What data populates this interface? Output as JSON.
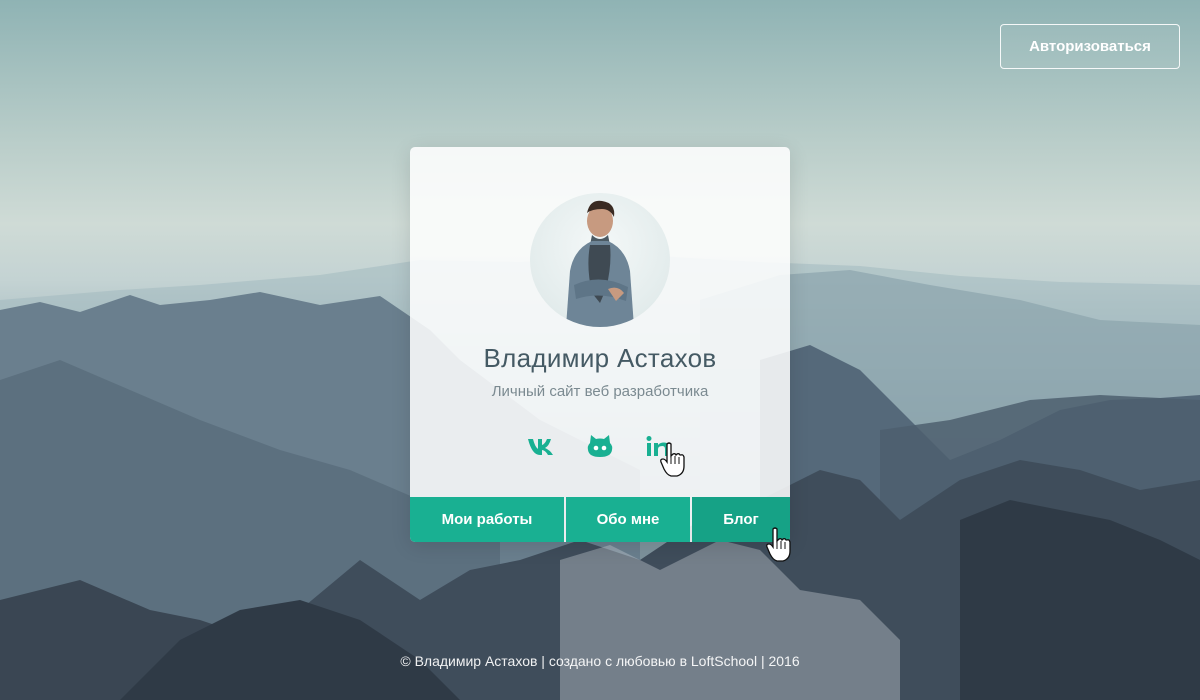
{
  "header": {
    "auth_label": "Авторизоваться"
  },
  "profile": {
    "name": "Владимир Астахов",
    "subtitle": "Личный сайт веб разработчика"
  },
  "socials": [
    {
      "icon": "vk-icon"
    },
    {
      "icon": "github-icon"
    },
    {
      "icon": "linkedin-icon"
    }
  ],
  "nav": {
    "items": [
      {
        "label": "Мои работы"
      },
      {
        "label": "Обо мне"
      },
      {
        "label": "Блог"
      }
    ]
  },
  "footer": {
    "text": "© Владимир Астахов | создано с любовью в LoftSchool | 2016"
  },
  "colors": {
    "accent": "#19b092",
    "name": "#455a64"
  }
}
